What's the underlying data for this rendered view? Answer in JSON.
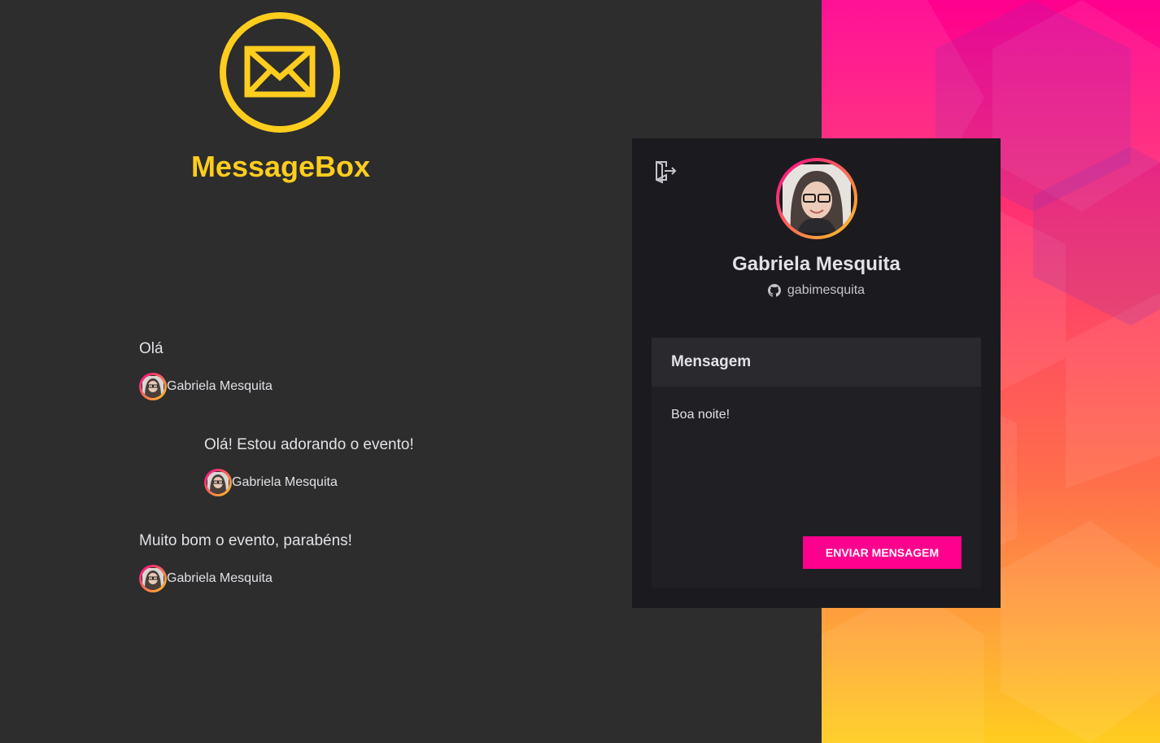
{
  "app": {
    "brand": "MessageBox",
    "logo_icon": "envelope-icon",
    "accent_color": "#ffcd1e",
    "primary_color": "#ff008e"
  },
  "messages": [
    {
      "text": "Olá",
      "author": "Gabriela Mesquita"
    },
    {
      "text": "Olá! Estou adorando o evento!",
      "author": "Gabriela Mesquita"
    },
    {
      "text": "Muito bom o evento, parabéns!",
      "author": "Gabriela Mesquita"
    }
  ],
  "profile": {
    "name": "Gabriela Mesquita",
    "login": "gabimesquita",
    "logout_icon": "sign-out-icon",
    "github_icon": "github-icon"
  },
  "form": {
    "title": "Mensagem",
    "message_value": "Boa noite!",
    "submit_label": "ENVIAR MENSAGEM"
  }
}
